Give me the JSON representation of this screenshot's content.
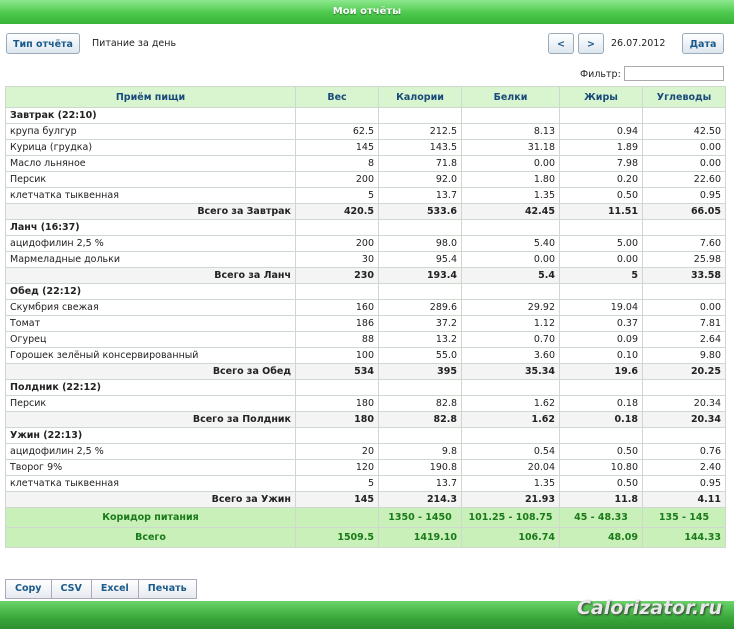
{
  "window": {
    "title": "Мои отчёты"
  },
  "toolbar": {
    "report_type_label": "Тип отчёта",
    "report_name": "Питание за день",
    "prev_label": "<",
    "next_label": ">",
    "date": "26.07.2012",
    "date_button_label": "Дата",
    "filter_label": "Фильтр:",
    "filter_value": ""
  },
  "table": {
    "headers": [
      "Приём пищи",
      "Вес",
      "Калории",
      "Белки",
      "Жиры",
      "Углеводы"
    ],
    "meals": [
      {
        "name": "Завтрак (22:10)",
        "items": [
          [
            "крупа булгур",
            "62.5",
            "212.5",
            "8.13",
            "0.94",
            "42.50"
          ],
          [
            "Курица (грудка)",
            "145",
            "143.5",
            "31.18",
            "1.89",
            "0.00"
          ],
          [
            "Масло льняное",
            "8",
            "71.8",
            "0.00",
            "7.98",
            "0.00"
          ],
          [
            "Персик",
            "200",
            "92.0",
            "1.80",
            "0.20",
            "22.60"
          ],
          [
            "клетчатка тыквенная",
            "5",
            "13.7",
            "1.35",
            "0.50",
            "0.95"
          ]
        ],
        "total": [
          "Всего за Завтрак",
          "420.5",
          "533.6",
          "42.45",
          "11.51",
          "66.05"
        ]
      },
      {
        "name": "Ланч (16:37)",
        "items": [
          [
            "ацидофилин 2,5 %",
            "200",
            "98.0",
            "5.40",
            "5.00",
            "7.60"
          ],
          [
            "Мармеладные дольки",
            "30",
            "95.4",
            "0.00",
            "0.00",
            "25.98"
          ]
        ],
        "total": [
          "Всего за Ланч",
          "230",
          "193.4",
          "5.4",
          "5",
          "33.58"
        ]
      },
      {
        "name": "Обед (22:12)",
        "items": [
          [
            "Скумбрия свежая",
            "160",
            "289.6",
            "29.92",
            "19.04",
            "0.00"
          ],
          [
            "Томат",
            "186",
            "37.2",
            "1.12",
            "0.37",
            "7.81"
          ],
          [
            "Огурец",
            "88",
            "13.2",
            "0.70",
            "0.09",
            "2.64"
          ],
          [
            "Горошек зелёный консервированный",
            "100",
            "55.0",
            "3.60",
            "0.10",
            "9.80"
          ]
        ],
        "total": [
          "Всего за Обед",
          "534",
          "395",
          "35.34",
          "19.6",
          "20.25"
        ]
      },
      {
        "name": "Полдник (22:12)",
        "items": [
          [
            "Персик",
            "180",
            "82.8",
            "1.62",
            "0.18",
            "20.34"
          ]
        ],
        "total": [
          "Всего за Полдник",
          "180",
          "82.8",
          "1.62",
          "0.18",
          "20.34"
        ]
      },
      {
        "name": "Ужин (22:13)",
        "items": [
          [
            "ацидофилин 2,5 %",
            "20",
            "9.8",
            "0.54",
            "0.50",
            "0.76"
          ],
          [
            "Творог 9%",
            "120",
            "190.8",
            "20.04",
            "10.80",
            "2.40"
          ],
          [
            "клетчатка тыквенная",
            "5",
            "13.7",
            "1.35",
            "0.50",
            "0.95"
          ]
        ],
        "total": [
          "Всего за Ужин",
          "145",
          "214.3",
          "21.93",
          "11.8",
          "4.11"
        ]
      }
    ],
    "corridor": [
      "Коридор питания",
      "",
      "1350 - 1450",
      "101.25 - 108.75",
      "45 - 48.33",
      "135 - 145"
    ],
    "grand_total": [
      "Всего",
      "1509.5",
      "1419.10",
      "106.74",
      "48.09",
      "144.33"
    ]
  },
  "export_buttons": [
    "Copy",
    "CSV",
    "Excel",
    "Печать"
  ],
  "watermark": "Calorizator.ru",
  "colors": {
    "accent_green": "#3aa83a",
    "header_bg": "#d8f5d0",
    "link_blue": "#1a5a8a"
  }
}
